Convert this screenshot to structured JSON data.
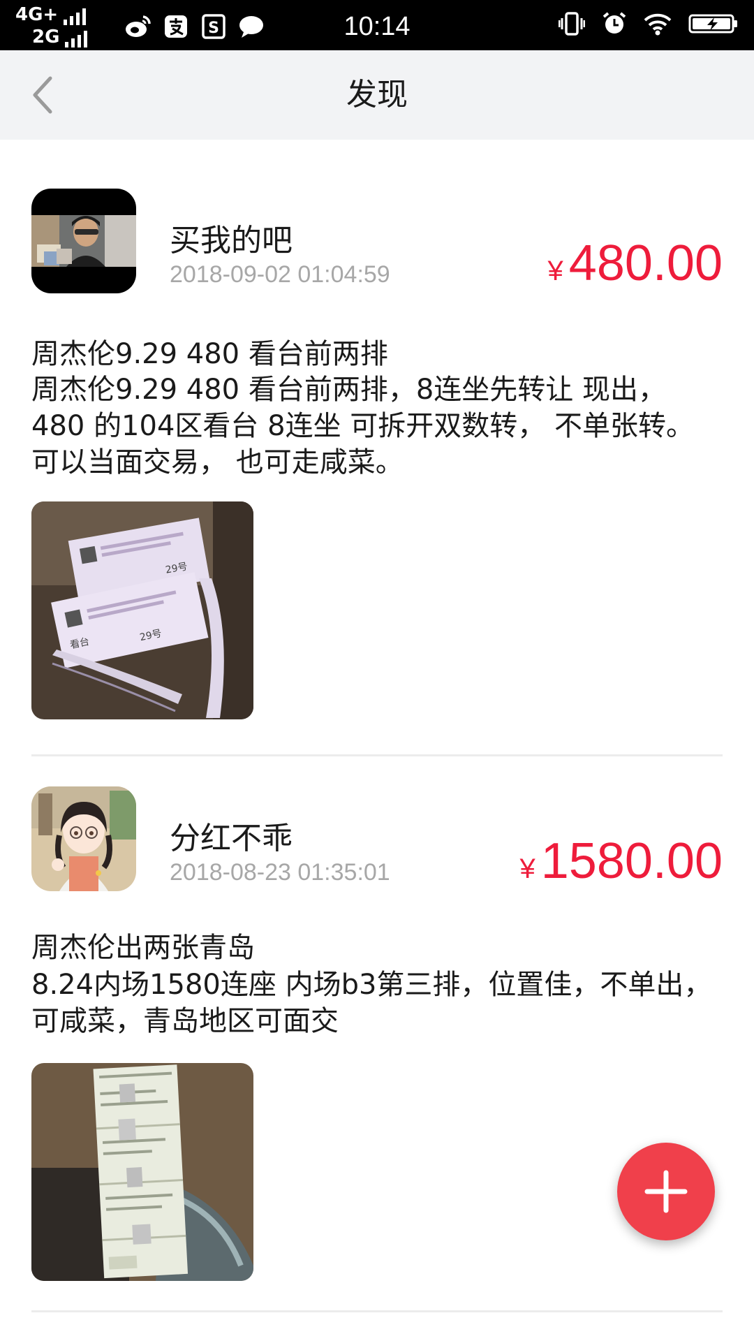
{
  "status_bar": {
    "network_top": "4G+",
    "network_bottom": "2G",
    "time": "10:14",
    "app_icons": [
      "weibo-icon",
      "alipay-icon",
      "taobao-icon",
      "chat-bubble-icon"
    ],
    "right_icons": [
      "vibrate-icon",
      "alarm-icon",
      "wifi-icon",
      "battery-charging-icon"
    ]
  },
  "header": {
    "title": "发现",
    "back_icon": "chevron-left-icon"
  },
  "posts": [
    {
      "author": "买我的吧",
      "date": "2018-09-02 01:04:59",
      "currency": "¥",
      "price": "480.00",
      "title": "周杰伦9.29 480 看台前两排",
      "description": "周杰伦9.29 480 看台前两排，8连坐先转让 现出，480 的104区看台 8连坐 可拆开双数转， 不单张转。可以当面交易， 也可走咸菜。"
    },
    {
      "author": "分红不乖",
      "date": "2018-08-23 01:35:01",
      "currency": "¥",
      "price": "1580.00",
      "title": "周杰伦出两张青岛",
      "description": "8.24内场1580连座 内场b3第三排，位置佳，不单出，可咸菜，青岛地区可面交"
    }
  ],
  "fab": {
    "icon": "plus-icon"
  },
  "colors": {
    "accent": "#ee1c3b",
    "fab": "#f0404b",
    "header_bg": "#f2f3f5"
  }
}
